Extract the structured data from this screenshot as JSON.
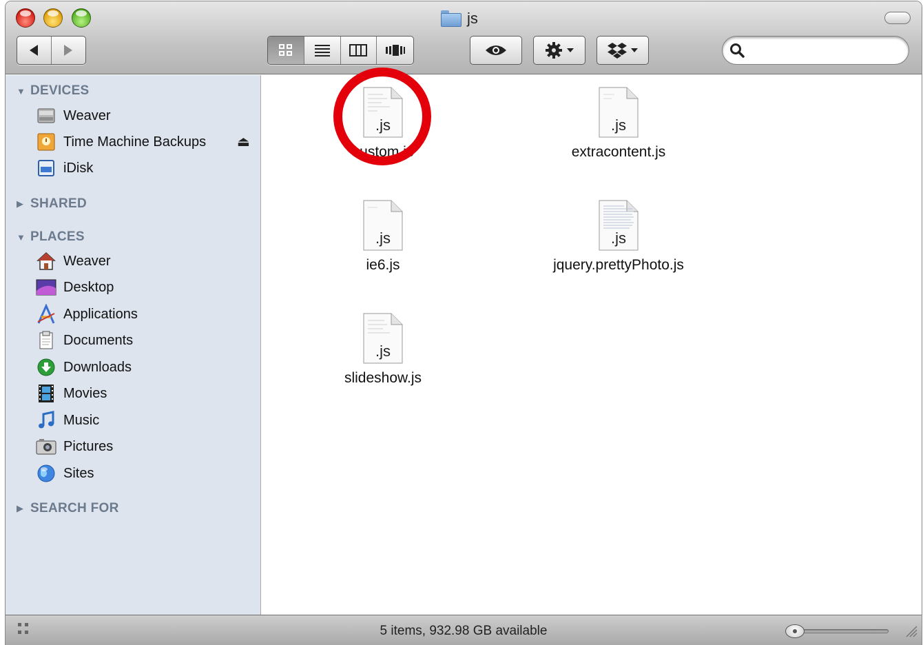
{
  "window": {
    "title": "js"
  },
  "toolbar": {
    "back_icon": "back-arrow-icon",
    "forward_icon": "forward-arrow-icon",
    "view_modes": [
      "icon-view-icon",
      "list-view-icon",
      "column-view-icon",
      "coverflow-view-icon"
    ],
    "selected_view": "icon",
    "search_placeholder": ""
  },
  "sidebar": {
    "sections": {
      "devices": "DEVICES",
      "shared": "SHARED",
      "places": "PLACES",
      "search_for": "SEARCH FOR"
    },
    "devices": [
      {
        "label": "Weaver",
        "icon": "hard-drive-icon"
      },
      {
        "label": "Time Machine Backups",
        "icon": "time-machine-drive-icon"
      },
      {
        "label": "iDisk",
        "icon": "idisk-icon"
      }
    ],
    "places": [
      {
        "label": "Weaver",
        "icon": "home-icon"
      },
      {
        "label": "Desktop",
        "icon": "desktop-icon"
      },
      {
        "label": "Applications",
        "icon": "applications-icon"
      },
      {
        "label": "Documents",
        "icon": "documents-icon"
      },
      {
        "label": "Downloads",
        "icon": "downloads-icon"
      },
      {
        "label": "Movies",
        "icon": "movies-icon"
      },
      {
        "label": "Music",
        "icon": "music-icon"
      },
      {
        "label": "Pictures",
        "icon": "pictures-icon"
      },
      {
        "label": "Sites",
        "icon": "sites-icon"
      }
    ]
  },
  "files": [
    {
      "name": "custom.js",
      "badge": ".js"
    },
    {
      "name": "extracontent.js",
      "badge": ".js"
    },
    {
      "name": "ie6.js",
      "badge": ".js"
    },
    {
      "name": "jquery.prettyPhoto.js",
      "badge": ".js"
    },
    {
      "name": "slideshow.js",
      "badge": ".js"
    }
  ],
  "annotation": {
    "circled_file": "custom.js",
    "color": "#e3000b"
  },
  "status": {
    "text": "5 items, 932.98 GB available"
  },
  "colors": {
    "sidebar_bg": "#dde4ee",
    "section_header": "#6b7a8c"
  }
}
